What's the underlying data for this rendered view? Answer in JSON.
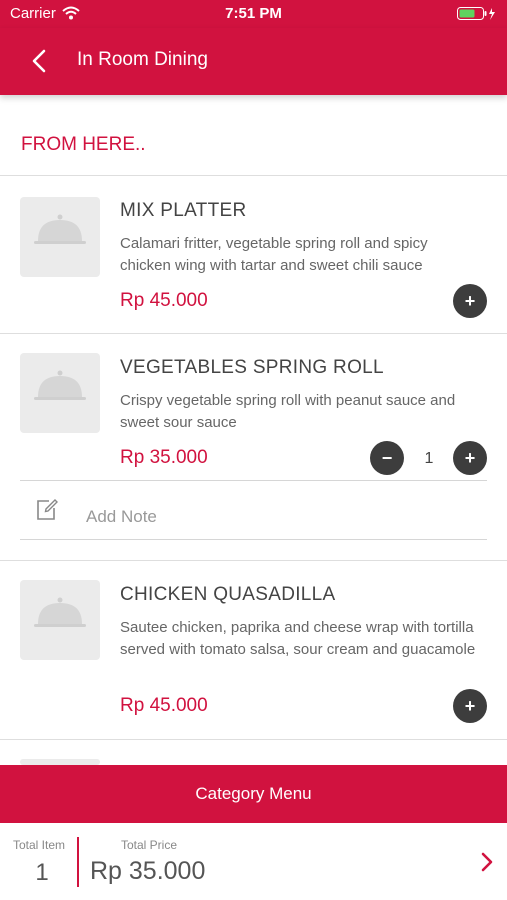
{
  "status_bar": {
    "carrier": "Carrier",
    "time": "7:51 PM"
  },
  "header": {
    "title": "In Room Dining"
  },
  "section": {
    "title": "FROM HERE.."
  },
  "items": [
    {
      "name": "MIX PLATTER",
      "description": "Calamari fritter, vegetable spring roll and spicy chicken wing with tartar and sweet chili sauce",
      "price": "Rp 45.000",
      "add_label": "+"
    },
    {
      "name": "VEGETABLES SPRING ROLL",
      "description": "Crispy vegetable spring roll with peanut sauce and sweet sour sauce",
      "price": "Rp 35.000",
      "minus_label": "−",
      "quantity": "1",
      "add_label": "+",
      "note_label": "Add Note"
    },
    {
      "name": "CHICKEN QUASADILLA",
      "description": "Sautee chicken, paprika and cheese wrap with tortilla served with tomato salsa, sour cream and guacamole",
      "price": "Rp 45.000",
      "add_label": "+"
    }
  ],
  "category_button": {
    "label": "Category Menu"
  },
  "footer": {
    "total_item_label": "Total Item",
    "total_item_value": "1",
    "total_price_label": "Total Price",
    "total_price_value": "Rp 35.000"
  },
  "colors": {
    "accent": "#d1123f",
    "button_dark": "#3d3d3d",
    "placeholder": "#ebebeb"
  },
  "icons": [
    "wifi-icon",
    "battery-icon",
    "back-chevron-icon",
    "food-cloche-icon",
    "edit-note-icon",
    "chevron-right-icon"
  ]
}
